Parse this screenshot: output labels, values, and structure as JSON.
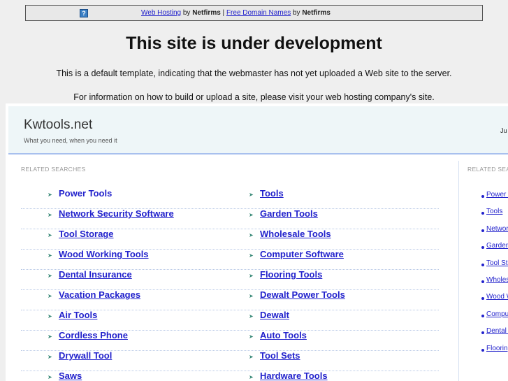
{
  "topbar": {
    "link1": "Web Hosting",
    "by1": " by ",
    "brand1": "Netfirms",
    "sep": " | ",
    "link2": "Free Domain Names",
    "by2": " by ",
    "brand2": "Netfirms",
    "help_icon": "?"
  },
  "title": "This site is under development",
  "line1": "This is a default template, indicating that the webmaster has not yet uploaded a Web site to the server.",
  "line2": "For information on how to build or upload a site, please visit your web hosting company's site.",
  "site": {
    "name": "Kwtools.net",
    "tagline": "What you need, when you need it",
    "date_partial": "Ju"
  },
  "related_label": "RELATED SEARCHES",
  "related_label_right": "RELATED SEA",
  "left_col": [
    "Power Tools",
    "Network Security Software",
    "Tool Storage",
    "Wood Working Tools",
    "Dental Insurance",
    "Vacation Packages",
    "Air Tools",
    "Cordless Phone",
    "Drywall Tool",
    "Saws"
  ],
  "right_col": [
    "Tools",
    "Garden Tools",
    "Wholesale Tools",
    "Computer Software",
    "Flooring Tools",
    "Dewalt Power Tools",
    "Dewalt",
    "Auto Tools",
    "Tool Sets",
    "Hardware Tools"
  ],
  "sidebar": [
    "Power Tools",
    "Tools",
    "Network Security Software",
    "Garden Tools",
    "Tool Storage",
    "Wholesale Tools",
    "Wood Working Tools",
    "Computer Software",
    "Dental Insurance",
    "Flooring Tools"
  ]
}
